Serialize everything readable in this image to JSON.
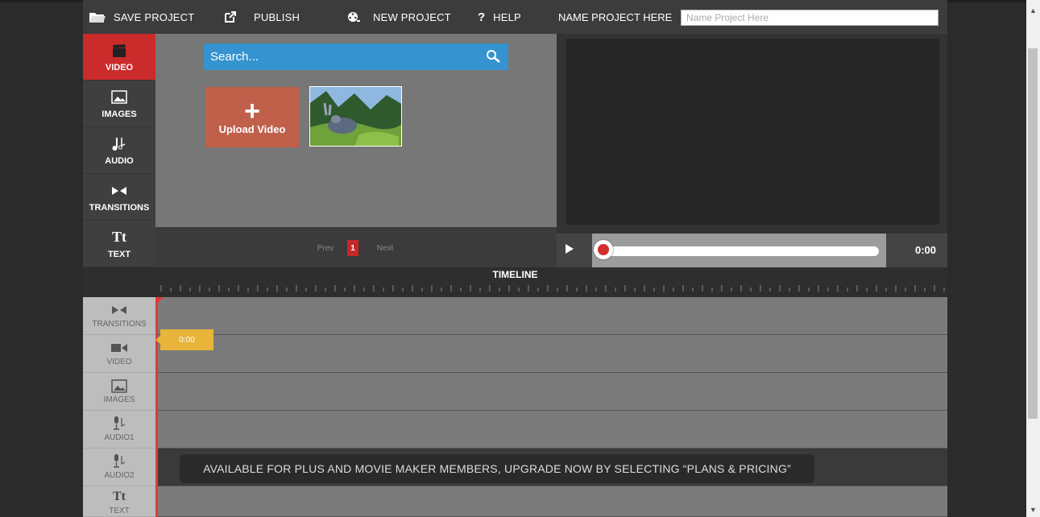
{
  "topbar": {
    "save_label": "SAVE PROJECT",
    "publish_label": "PUBLISH",
    "new_label": "NEW PROJECT",
    "help_label": "HELP",
    "name_label": "NAME PROJECT HERE",
    "name_placeholder": "Name Project Here"
  },
  "sidebar": {
    "items": [
      {
        "label": "VIDEO",
        "icon": "clapperboard-icon",
        "active": true
      },
      {
        "label": "IMAGES",
        "icon": "image-icon"
      },
      {
        "label": "AUDIO",
        "icon": "music-note-icon"
      },
      {
        "label": "TRANSITIONS",
        "icon": "transition-icon"
      },
      {
        "label": "TEXT",
        "icon": "text-icon",
        "glyph": "Tt"
      }
    ]
  },
  "library": {
    "search_placeholder": "Search...",
    "upload_label": "Upload Video"
  },
  "pager": {
    "prev": "Prev",
    "page": "1",
    "next": "Next"
  },
  "player": {
    "time": "0:00"
  },
  "timeline": {
    "title": "TIMELINE",
    "playhead_time": "0:00",
    "tracks": [
      {
        "label": "TRANSITIONS"
      },
      {
        "label": "VIDEO"
      },
      {
        "label": "IMAGES"
      },
      {
        "label": "AUDIO1"
      },
      {
        "label": "AUDIO2"
      },
      {
        "label": "TEXT",
        "glyph": "Tt"
      }
    ],
    "notice": "AVAILABLE FOR PLUS AND MOVIE MAKER MEMBERS, UPGRADE NOW BY SELECTING “PLANS & PRICING”"
  },
  "colors": {
    "accent_red": "#cc2b2b",
    "search_blue": "#3593cf",
    "upload_tile": "#c0604b",
    "time_bubble": "#e8b43a"
  }
}
